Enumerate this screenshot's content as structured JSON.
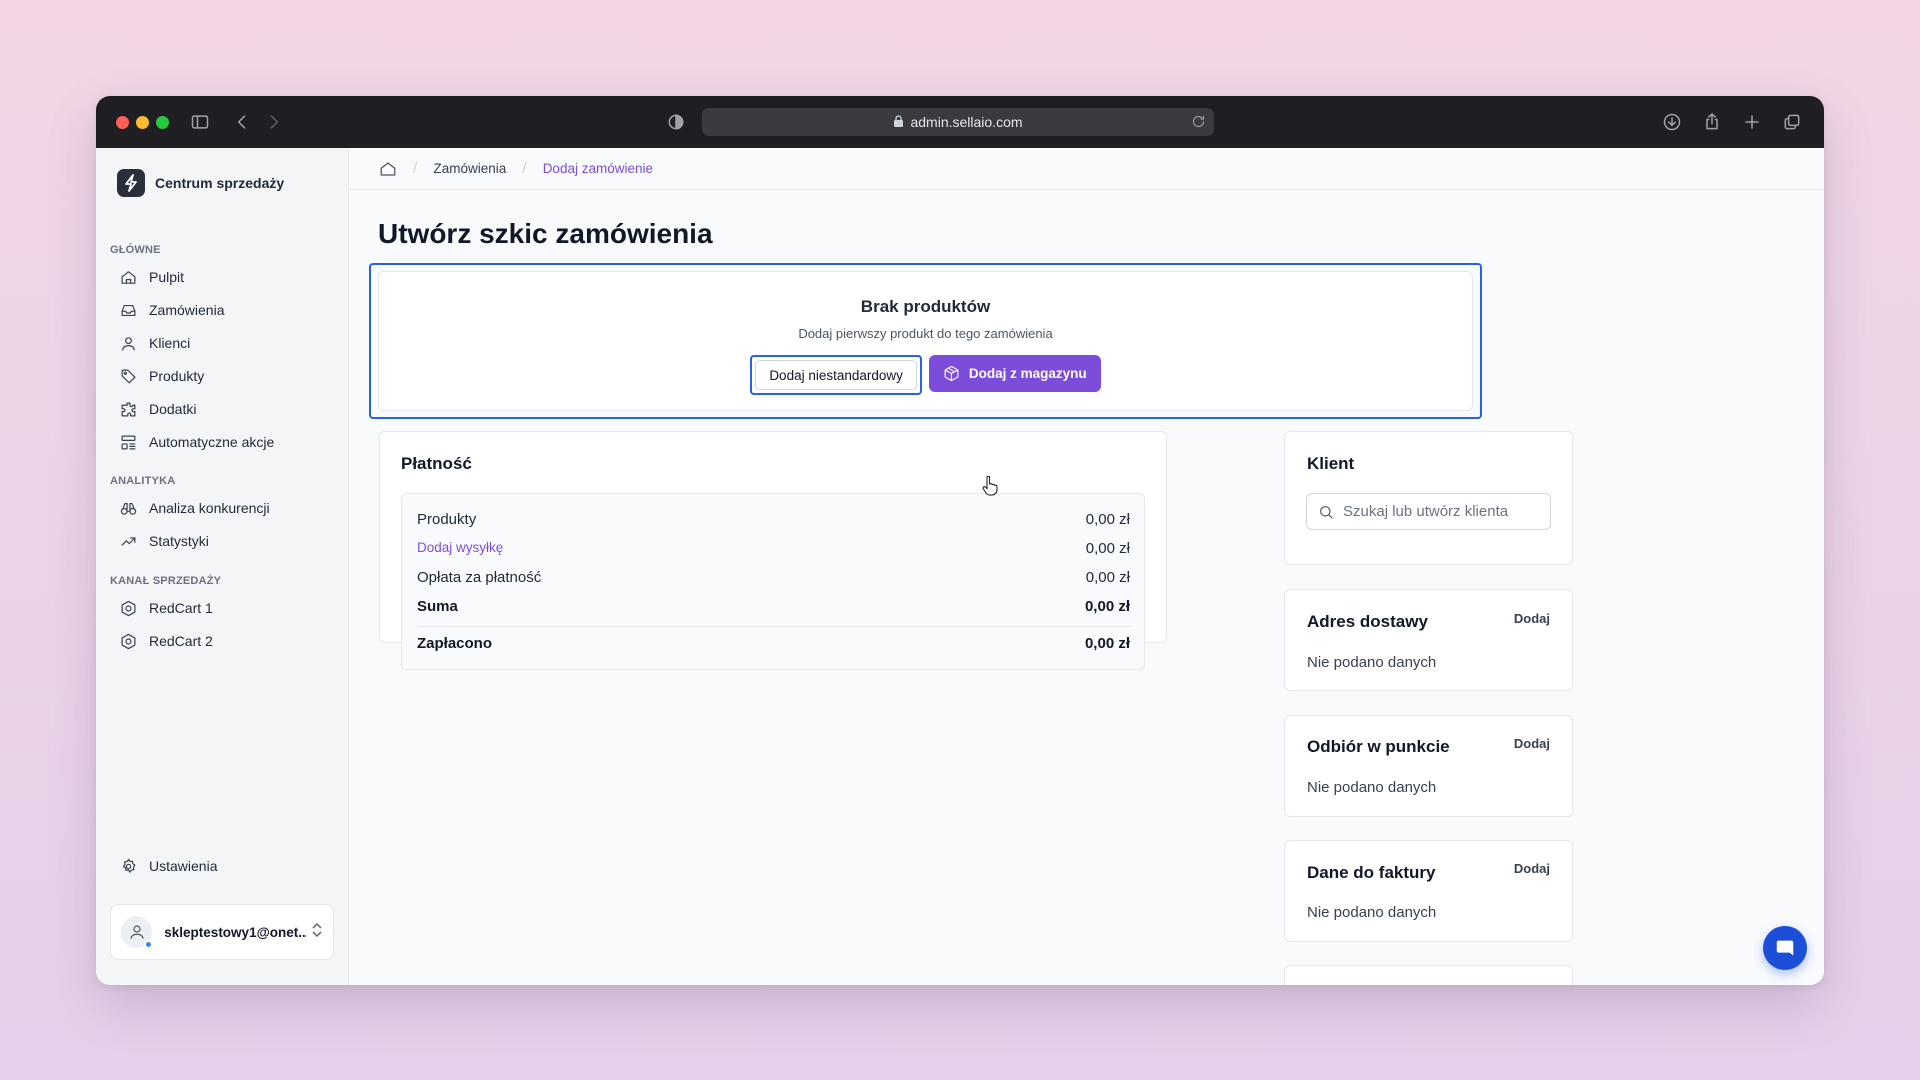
{
  "browser": {
    "url": "admin.sellaio.com"
  },
  "sidebar": {
    "brand": "Centrum sprzedaży",
    "sections": [
      {
        "title": "GŁÓWNE",
        "items": [
          {
            "label": "Pulpit",
            "icon": "home-icon"
          },
          {
            "label": "Zamówienia",
            "icon": "inbox-icon"
          },
          {
            "label": "Klienci",
            "icon": "user-icon"
          },
          {
            "label": "Produkty",
            "icon": "tag-icon"
          },
          {
            "label": "Dodatki",
            "icon": "puzzle-icon"
          },
          {
            "label": "Automatyczne akcje",
            "icon": "workflow-icon"
          }
        ]
      },
      {
        "title": "ANALITYKA",
        "items": [
          {
            "label": "Analiza konkurencji",
            "icon": "binoculars-icon"
          },
          {
            "label": "Statystyki",
            "icon": "trending-up-icon"
          }
        ]
      },
      {
        "title": "KANAŁ SPRZEDAŻY",
        "items": [
          {
            "label": "RedCart 1",
            "icon": "redcart-icon"
          },
          {
            "label": "RedCart 2",
            "icon": "redcart-icon"
          }
        ]
      }
    ],
    "settings_label": "Ustawienia",
    "user_email": "skleptestowy1@onet..."
  },
  "breadcrumb": {
    "items": [
      "Zamówienia",
      "Dodaj zamówienie"
    ]
  },
  "page": {
    "title": "Utwórz szkic zamówienia"
  },
  "products": {
    "empty_title": "Brak produktów",
    "empty_subtitle": "Dodaj pierwszy produkt do tego zamówienia",
    "btn_custom": "Dodaj niestandardowy",
    "btn_warehouse": "Dodaj z magazynu"
  },
  "payment": {
    "title": "Płatność",
    "rows": [
      {
        "label": "Produkty",
        "value": "0,00 zł"
      },
      {
        "label": "Dodaj wysyłkę",
        "value": "0,00 zł"
      },
      {
        "label": "Opłata za płatność",
        "value": "0,00 zł"
      },
      {
        "label": "Suma",
        "value": "0,00 zł"
      },
      {
        "label": "Zapłacono",
        "value": "0,00 zł"
      }
    ]
  },
  "client": {
    "title": "Klient",
    "search_placeholder": "Szukaj lub utwórz klienta"
  },
  "shipping_address": {
    "title": "Adres dostawy",
    "action": "Dodaj",
    "empty": "Nie podano danych"
  },
  "pickup_point": {
    "title": "Odbiór w punkcie",
    "action": "Dodaj",
    "empty": "Nie podano danych"
  },
  "invoice": {
    "title": "Dane do faktury",
    "action": "Dodaj",
    "empty": "Nie podano danych"
  },
  "colors": {
    "accent": "#7c4ddb",
    "focus": "#2563eb",
    "chat": "#1d4ed8"
  }
}
